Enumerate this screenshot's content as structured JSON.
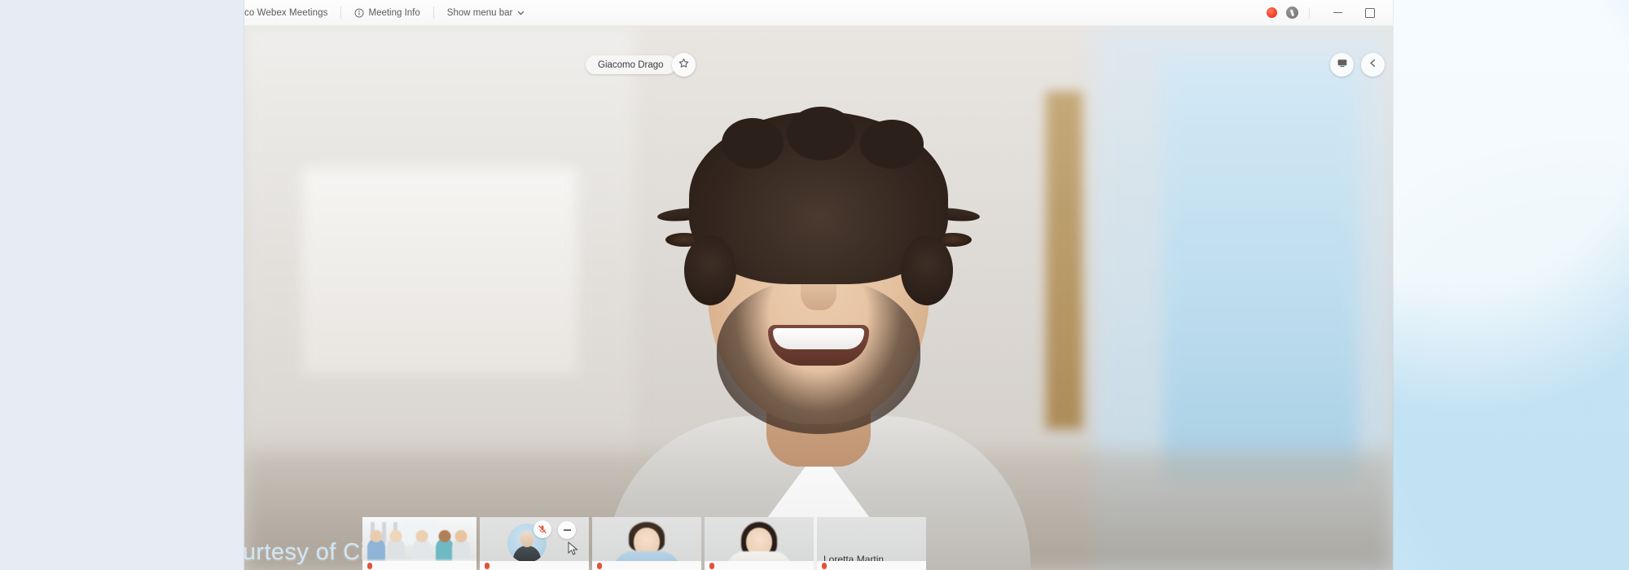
{
  "window": {
    "title": "co Webex Meetings",
    "menu": {
      "meeting_info_label": "Meeting Info",
      "meeting_info_icon": "info-circle-icon",
      "show_menu_bar_label": "Show menu bar",
      "show_menu_bar_icon": "chevron-down-icon"
    },
    "controls": {
      "record_indicator": "record-dot-icon",
      "record_pause": "recording-pause-icon",
      "minimize": "minimize-icon",
      "maximize": "maximize-icon"
    }
  },
  "stage": {
    "active_speaker": {
      "name": "Giacomo Drago",
      "pin_icon": "star-icon"
    },
    "top_right_buttons": [
      {
        "name": "layout-view-button",
        "icon": "screen-icon"
      },
      {
        "name": "collapse-panel-button",
        "icon": "chevron-left-icon"
      }
    ],
    "watermark": "Courtesy of Cisco"
  },
  "filmstrip": {
    "thumbnails": [
      {
        "name": "",
        "kind": "group-room",
        "muted": false
      },
      {
        "name": "",
        "kind": "avatar",
        "muted": true,
        "mute_icon": "mic-muted-icon",
        "more_icon": "more-minus-icon"
      },
      {
        "name": "",
        "kind": "face-man",
        "muted": true
      },
      {
        "name": "",
        "kind": "face-woman",
        "muted": true
      },
      {
        "name": "Loretta Martin",
        "kind": "name-only",
        "muted": true
      }
    ]
  },
  "desktop": {
    "external_thumbnail": "blonde-participant-thumbnail"
  },
  "colors": {
    "record_red": "#f4442c",
    "watermark_blue": "#cfe6f5",
    "desktop_right": "#d6edfa",
    "desktop_left": "#e7ebf3",
    "titlebar": "#f7f7f7"
  }
}
